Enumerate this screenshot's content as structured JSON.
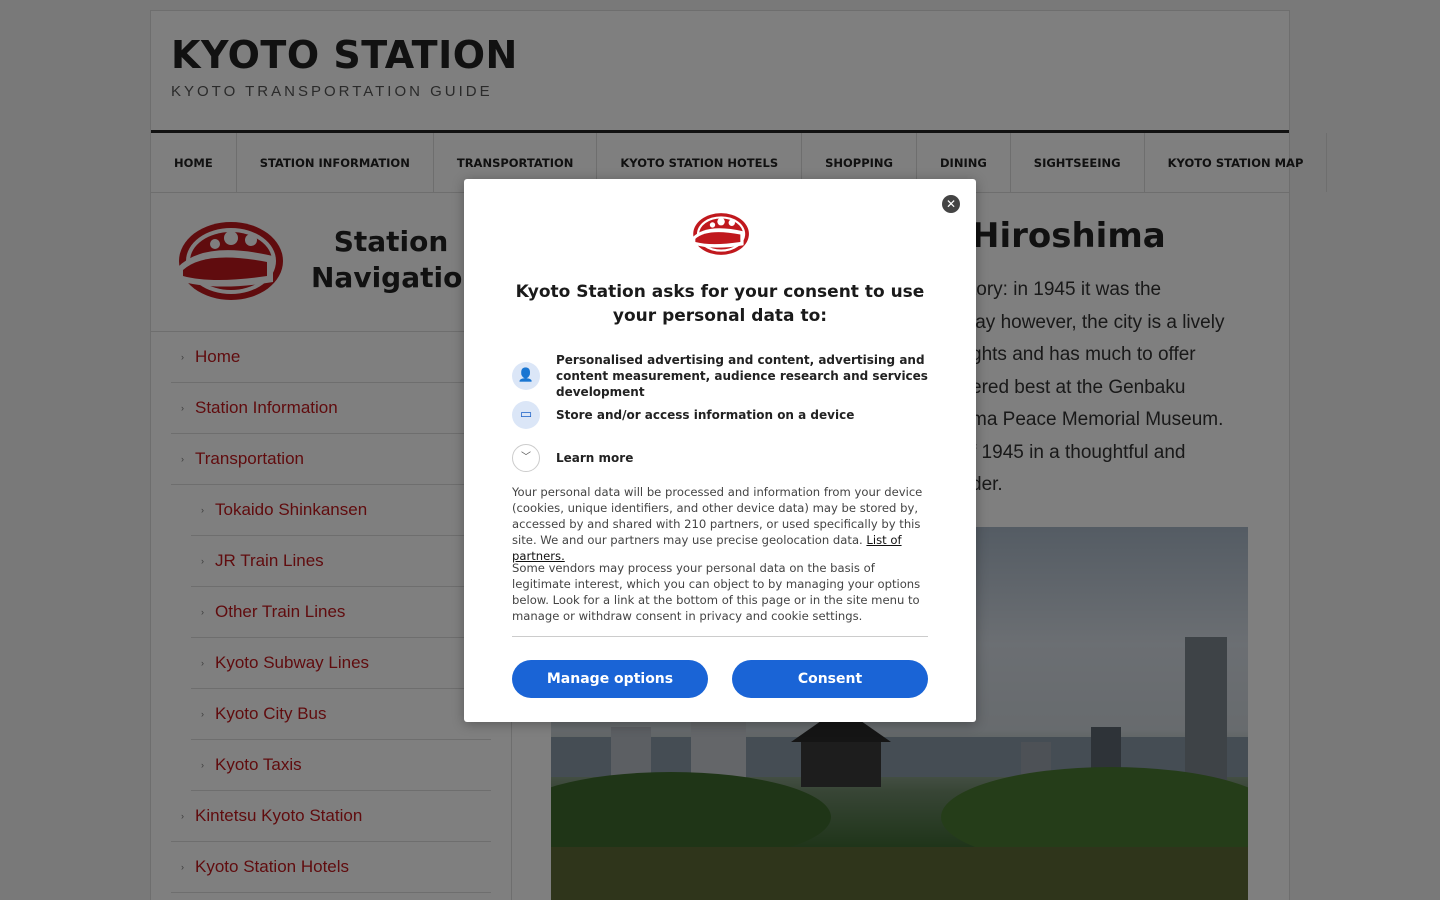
{
  "site": {
    "title": "KYOTO STATION",
    "tagline": "KYOTO TRANSPORTATION GUIDE"
  },
  "nav": [
    "HOME",
    "STATION INFORMATION",
    "TRANSPORTATION",
    "KYOTO STATION HOTELS",
    "SHOPPING",
    "DINING",
    "SIGHTSEEING",
    "KYOTO STATION MAP"
  ],
  "sidebar": {
    "title": "Station Navigation",
    "menu": [
      {
        "label": "Home",
        "sub": false
      },
      {
        "label": "Station Information",
        "sub": false
      },
      {
        "label": "Transportation",
        "sub": false
      },
      {
        "label": "Tokaido Shinkansen",
        "sub": true
      },
      {
        "label": "JR Train Lines",
        "sub": true
      },
      {
        "label": "Other Train Lines",
        "sub": true
      },
      {
        "label": "Kyoto Subway Lines",
        "sub": true
      },
      {
        "label": "Kyoto City Bus",
        "sub": true
      },
      {
        "label": "Kyoto Taxis",
        "sub": true
      },
      {
        "label": "Kintetsu Kyoto Station",
        "sub": false
      },
      {
        "label": "Kyoto Station Hotels",
        "sub": false
      }
    ]
  },
  "content": {
    "title_visible": "Hiroshima",
    "text_visible": "tory: in 1945 it was the\nlay however, the city is a lively\nghts and has much to offer\nered best at the Genbaku\nma Peace Memorial Museum.\nf 1945 in a thoughtful and\nder."
  },
  "consent": {
    "title": "Kyoto Station asks for your consent to use your personal data to:",
    "purposes": [
      {
        "icon": "person-icon",
        "text": "Personalised advertising and content, advertising and content measurement, audience research and services development"
      },
      {
        "icon": "device-icon",
        "text": "Store and/or access information on a device"
      }
    ],
    "learn_more": "Learn more",
    "para1": "Your personal data will be processed and information from your device (cookies, unique identifiers, and other device data) may be stored by, accessed by and shared with 210 partners, or used specifically by this site. We and our partners may use precise geolocation data.",
    "partners_link": "List of partners.",
    "para2": "Some vendors may process your personal data on the basis of legitimate interest, which you can object to by managing your options below. Look for a link at the bottom of this page or in the site menu to manage or withdraw consent in privacy and cookie settings.",
    "manage_label": "Manage options",
    "consent_label": "Consent",
    "close_glyph": "✕"
  },
  "colors": {
    "accent_red": "#c0181d",
    "button_blue": "#1a64d6"
  }
}
